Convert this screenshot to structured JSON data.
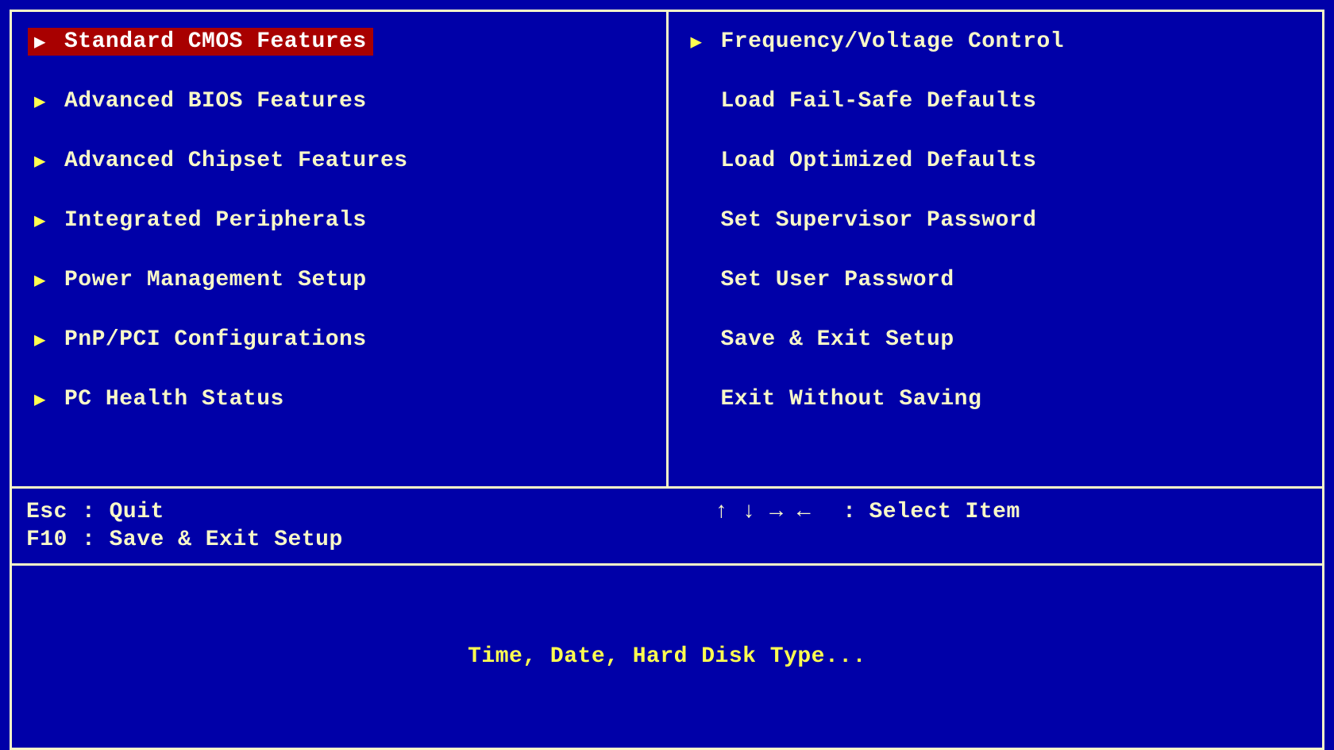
{
  "menu": {
    "left": [
      {
        "label": "Standard CMOS Features",
        "has_submenu": true,
        "selected": true
      },
      {
        "label": "Advanced BIOS Features",
        "has_submenu": true,
        "selected": false
      },
      {
        "label": "Advanced Chipset Features",
        "has_submenu": true,
        "selected": false
      },
      {
        "label": "Integrated Peripherals",
        "has_submenu": true,
        "selected": false
      },
      {
        "label": "Power Management Setup",
        "has_submenu": true,
        "selected": false
      },
      {
        "label": "PnP/PCI Configurations",
        "has_submenu": true,
        "selected": false
      },
      {
        "label": "PC Health Status",
        "has_submenu": true,
        "selected": false
      }
    ],
    "right": [
      {
        "label": "Frequency/Voltage Control",
        "has_submenu": true,
        "selected": false
      },
      {
        "label": "Load Fail-Safe Defaults",
        "has_submenu": false,
        "selected": false
      },
      {
        "label": "Load Optimized Defaults",
        "has_submenu": false,
        "selected": false
      },
      {
        "label": "Set Supervisor Password",
        "has_submenu": false,
        "selected": false
      },
      {
        "label": "Set User Password",
        "has_submenu": false,
        "selected": false
      },
      {
        "label": "Save & Exit Setup",
        "has_submenu": false,
        "selected": false
      },
      {
        "label": "Exit Without Saving",
        "has_submenu": false,
        "selected": false
      }
    ]
  },
  "help": {
    "esc_key": "Esc",
    "esc_label": ": Quit",
    "f10_key": "F10",
    "f10_label": ": Save & Exit Setup",
    "arrows": "↑ ↓ → ←",
    "arrows_sep": ":",
    "arrows_label": "Select Item"
  },
  "description": "Time, Date, Hard Disk Type...",
  "icons": {
    "submenu_arrow": "▶"
  },
  "colors": {
    "background": "#0000a8",
    "text": "#f8f8c8",
    "highlight_bg": "#a80000",
    "highlight_text": "#ffffff",
    "accent_yellow": "#ffff50"
  }
}
